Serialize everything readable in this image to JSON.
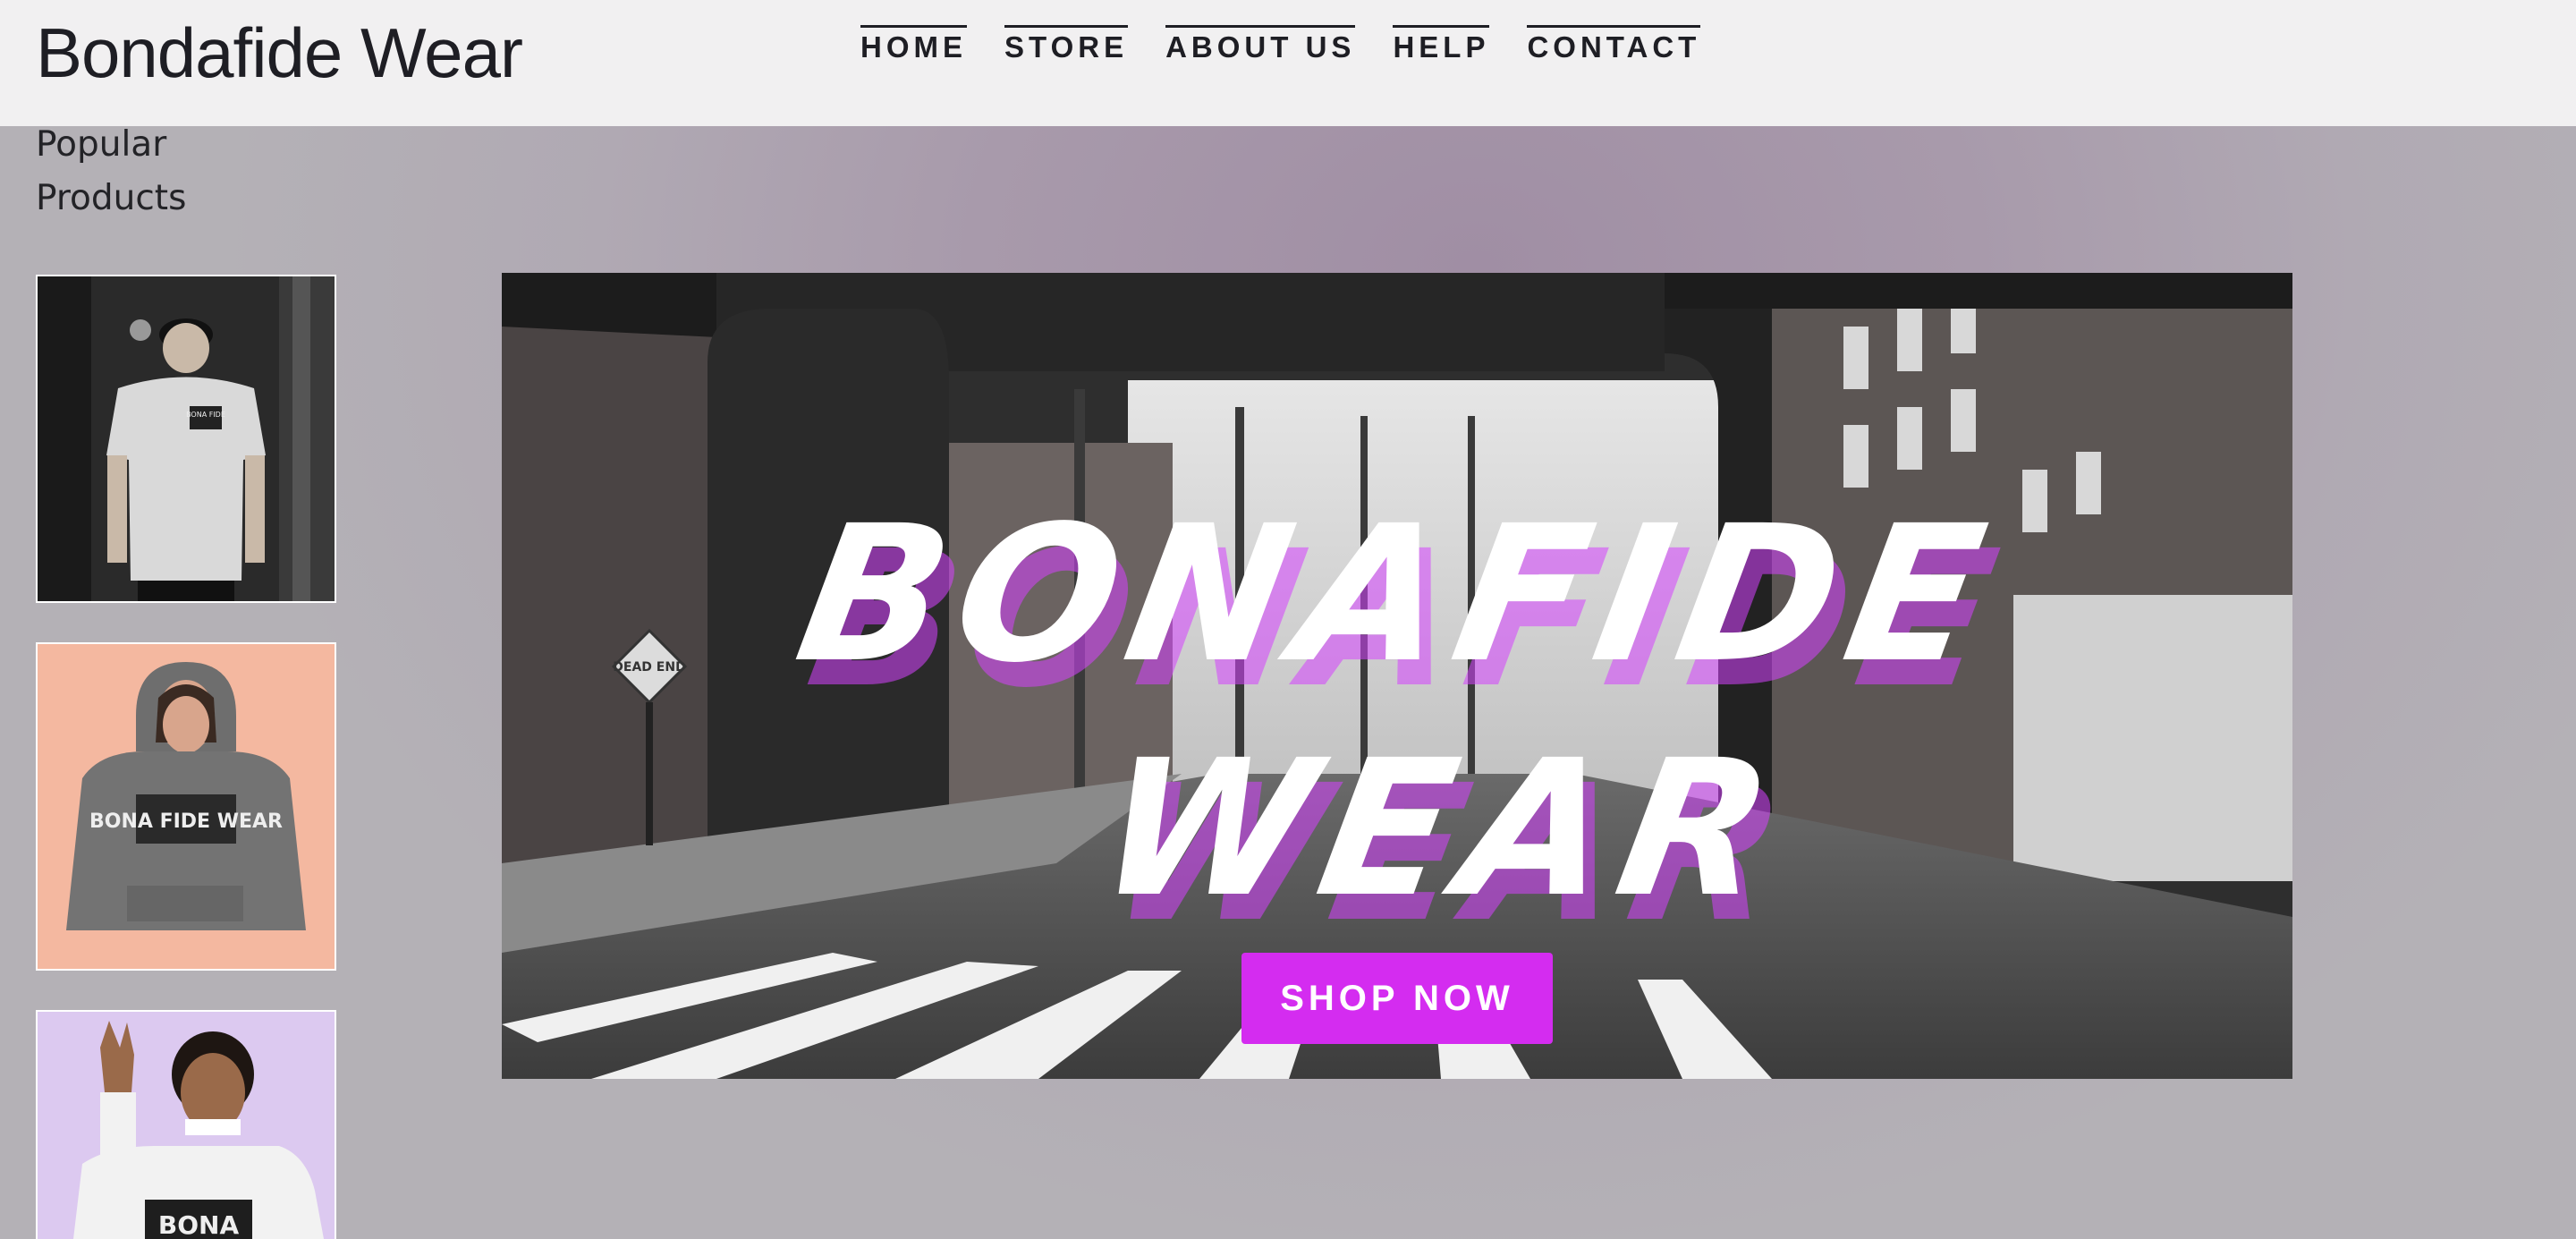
{
  "header": {
    "brand": "Bondafide Wear",
    "nav": [
      "HOME",
      "STORE",
      "ABOUT US",
      "HELP",
      "CONTACT"
    ]
  },
  "sidebar": {
    "title_line1": "Popular",
    "title_line2": "Products",
    "products": [
      {
        "image": "man-black-cap-white-tee",
        "print": "BONA FIDE"
      },
      {
        "image": "woman-grey-hoodie",
        "print": "BONA FIDE WEAR"
      },
      {
        "image": "man-white-sweatshirt-peace-sign",
        "print": "BONA"
      }
    ]
  },
  "banner": {
    "headline_line1": "BONAFIDE",
    "headline_line2": "WEAR",
    "cta_label": "SHOP NOW",
    "sign_text": "DEAD END"
  },
  "colors": {
    "header_bg": "#f1f0f1",
    "accent": "#d42cf0",
    "text": "#1e1e24"
  }
}
